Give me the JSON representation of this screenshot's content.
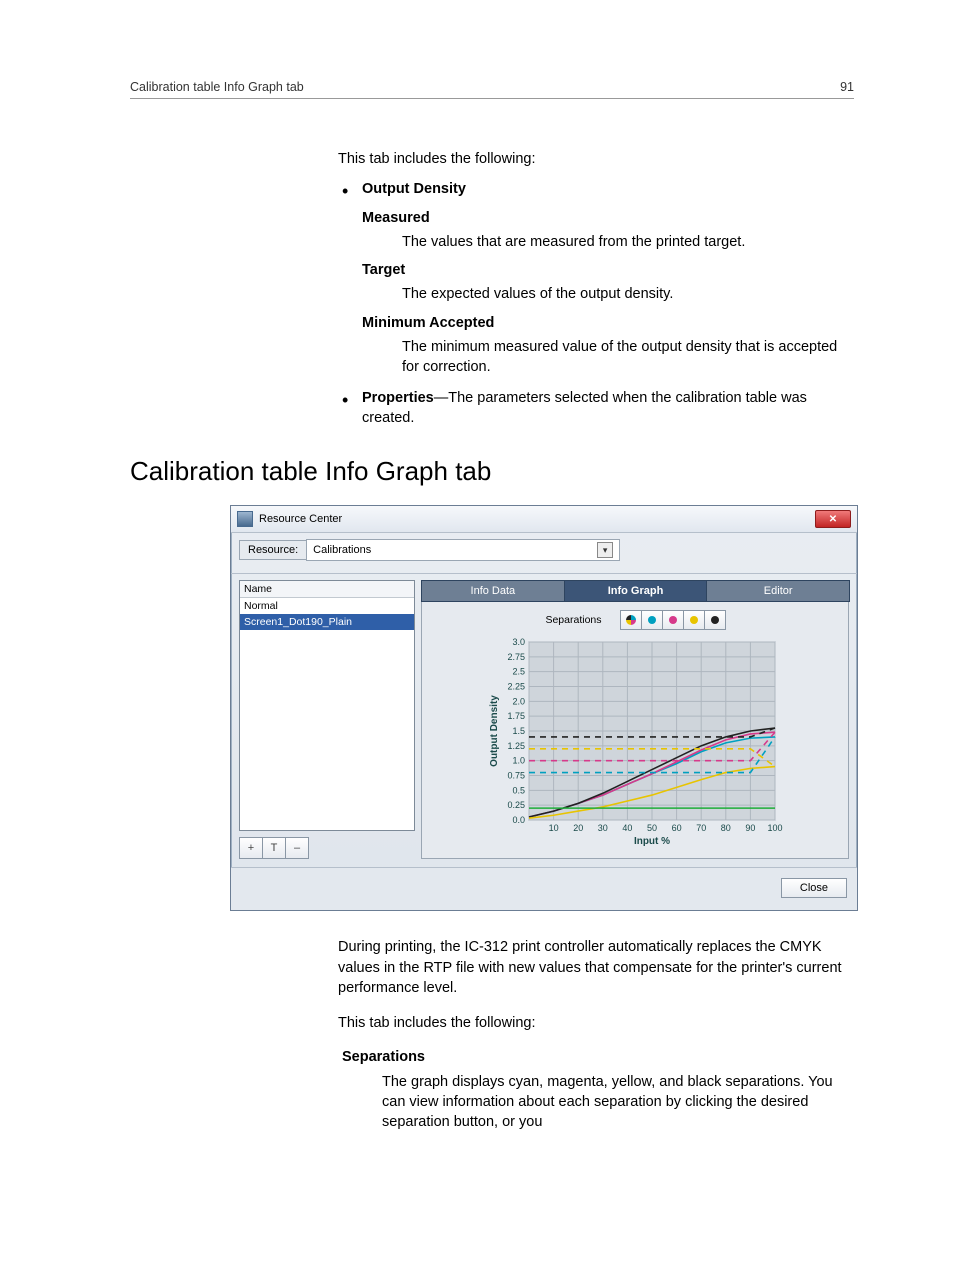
{
  "header": {
    "left": "Calibration table Info Graph tab",
    "right": "91"
  },
  "intro": "This tab includes the following:",
  "bullets": {
    "output_density_label": "Output Density",
    "measured_label": "Measured",
    "measured_text": "The values that are measured from the printed target.",
    "target_label": "Target",
    "target_text": "The expected values of the output density.",
    "min_label": "Minimum Accepted",
    "min_text": "The minimum measured value of the output density that is accepted for correction.",
    "properties_label": "Properties",
    "properties_text": "—The parameters selected when the calibration table was created."
  },
  "section_title": "Calibration table Info Graph tab",
  "dialog": {
    "title": "Resource Center",
    "resource_label": "Resource:",
    "resource_value": "Calibrations",
    "list_header": "Name",
    "list_items": [
      "Normal",
      "Screen1_Dot190_Plain"
    ],
    "selected_index": 1,
    "tabs": {
      "info_data": "Info Data",
      "info_graph": "Info Graph",
      "editor": "Editor"
    },
    "separations_label": "Separations",
    "close_label": "Close",
    "tool_icons": {
      "add": "+",
      "rename": "T",
      "remove": "–"
    },
    "chart": {
      "ylabel": "Output Density",
      "xlabel": "Input %"
    }
  },
  "chart_data": {
    "type": "line",
    "title": "",
    "xlabel": "Input %",
    "ylabel": "Output Density",
    "xlim": [
      0,
      100
    ],
    "ylim": [
      0,
      3.0
    ],
    "x_ticks": [
      0,
      10,
      20,
      30,
      40,
      50,
      60,
      70,
      80,
      90,
      100
    ],
    "y_ticks": [
      0.0,
      0.25,
      0.5,
      0.75,
      1.0,
      1.25,
      1.5,
      1.75,
      2.0,
      2.25,
      2.5,
      2.75,
      3.0
    ],
    "x": [
      0,
      10,
      20,
      30,
      40,
      50,
      60,
      70,
      80,
      90,
      100
    ],
    "series": [
      {
        "name": "Cyan curve",
        "color": "#00a0c0",
        "values": [
          0.05,
          0.15,
          0.28,
          0.42,
          0.6,
          0.78,
          0.95,
          1.15,
          1.3,
          1.38,
          1.4
        ]
      },
      {
        "name": "Magenta curve",
        "color": "#d63a8b",
        "values": [
          0.05,
          0.15,
          0.28,
          0.42,
          0.6,
          0.78,
          0.98,
          1.18,
          1.35,
          1.45,
          1.48
        ]
      },
      {
        "name": "Black curve",
        "color": "#222222",
        "values": [
          0.05,
          0.15,
          0.28,
          0.45,
          0.65,
          0.85,
          1.05,
          1.25,
          1.4,
          1.5,
          1.55
        ]
      },
      {
        "name": "Yellow curve",
        "color": "#e8c400",
        "values": [
          0.03,
          0.08,
          0.15,
          0.22,
          0.32,
          0.42,
          0.55,
          0.68,
          0.8,
          0.87,
          0.9
        ]
      },
      {
        "name": "Green target",
        "color": "#1fae3a",
        "values": [
          0.2,
          0.2,
          0.2,
          0.2,
          0.2,
          0.2,
          0.2,
          0.2,
          0.2,
          0.2,
          0.2
        ]
      },
      {
        "name": "Cyan target",
        "color": "#00a0c0",
        "values": [
          0.8,
          0.8,
          0.8,
          0.8,
          0.8,
          0.8,
          0.8,
          0.8,
          0.8,
          0.8,
          1.4
        ],
        "dashed": true
      },
      {
        "name": "Magenta target",
        "color": "#d63a8b",
        "values": [
          1.0,
          1.0,
          1.0,
          1.0,
          1.0,
          1.0,
          1.0,
          1.0,
          1.0,
          1.0,
          1.48
        ],
        "dashed": true
      },
      {
        "name": "Yellow target",
        "color": "#e8c400",
        "values": [
          1.2,
          1.2,
          1.2,
          1.2,
          1.2,
          1.2,
          1.2,
          1.2,
          1.2,
          1.2,
          0.9
        ],
        "dashed": true
      },
      {
        "name": "Black target",
        "color": "#222222",
        "values": [
          1.4,
          1.4,
          1.4,
          1.4,
          1.4,
          1.4,
          1.4,
          1.4,
          1.4,
          1.4,
          1.55
        ],
        "dashed": true
      }
    ]
  },
  "after_dialog": {
    "p1": "During printing, the IC-312 print controller automatically replaces the CMYK values in the RTP file with new values that compensate for the printer's current performance level.",
    "p2": "This tab includes the following:",
    "sep_heading": "Separations",
    "sep_body": "The graph displays cyan, magenta, yellow, and black separations. You can view information about each separation by clicking the desired separation button, or you"
  }
}
